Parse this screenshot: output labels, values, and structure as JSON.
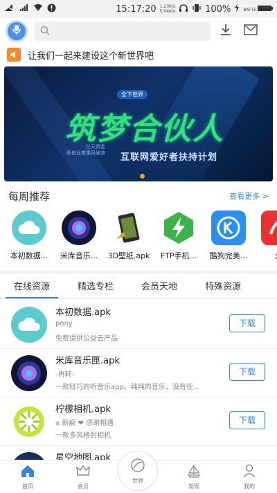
{
  "status_bar": {
    "time": "15:17:20",
    "speed_up": "1.23K/s",
    "speed_down": "5.04K/s",
    "battery": "100%",
    "battery_label": "BATTE"
  },
  "header": {
    "search_placeholder": "",
    "icons": [
      "mic-icon",
      "search-icon",
      "download-icon",
      "mail-icon"
    ]
  },
  "notice": {
    "text": "让我们一起来建设这个新世界吧"
  },
  "banner": {
    "tag": "全下世界",
    "title": "筑梦合伙人",
    "subtitle": "互联网爱好者扶持计划",
    "side_line1": "亿元资金",
    "side_line2": "助创业者乘风破浪"
  },
  "weekly": {
    "title": "每周推荐",
    "more": "查看更多 >",
    "apps": [
      {
        "label": "本初数据..."
      },
      {
        "label": "米库音乐..."
      },
      {
        "label": "3D壁纸.apk"
      },
      {
        "label": "FTP手机..."
      },
      {
        "label": "酷狗完美..."
      },
      {
        "label": "火"
      }
    ]
  },
  "tabs": [
    "在线资源",
    "精选专栏",
    "会员天地",
    "特殊资源"
  ],
  "resources": [
    {
      "name": "本初数据.apk",
      "author": "pony",
      "desc": "免费提供公益云产品",
      "button": "下载"
    },
    {
      "name": "米库音乐匣.apk",
      "author": "-冉轩-",
      "desc": "一款轻巧的听音乐app。纯纯的音乐，没有任...",
      "button": "下载"
    },
    {
      "name": "柠檬相机.apk",
      "author": "a 新痕 ❤ 感谢相遇",
      "desc": "一款多风格的相机",
      "button": "下载"
    },
    {
      "name": "星空地图.apk",
      "author": "",
      "desc": "",
      "button": ""
    }
  ],
  "bottom_nav": {
    "home": "首页",
    "vip": "会员",
    "world": "世界",
    "discover": "发现",
    "mine": "我的"
  },
  "colors": {
    "accent": "#3a85d6",
    "banner_title": "#34e07a",
    "notice_icon": "#f08a2b"
  }
}
